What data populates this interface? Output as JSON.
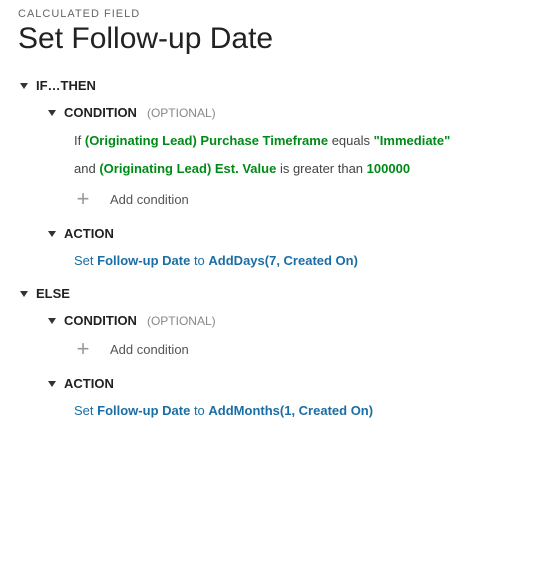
{
  "subtitle": "CALCULATED FIELD",
  "title": "Set Follow-up Date",
  "labels": {
    "ifthen": "IF…THEN",
    "condition": "CONDITION",
    "optional": "(OPTIONAL)",
    "action": "ACTION",
    "else": "ELSE",
    "add_condition": "Add condition"
  },
  "ifthen": {
    "conditions": [
      {
        "prefix": "If",
        "field": "(Originating Lead) Purchase Timeframe",
        "op": "equals",
        "value": "\"Immediate\""
      },
      {
        "prefix": "and",
        "field": "(Originating Lead) Est. Value",
        "op": "is greater than",
        "value": "100000"
      }
    ],
    "action": {
      "prefix": "Set",
      "field": "Follow-up Date",
      "mid": "to",
      "func": "AddDays(7, Created On)"
    }
  },
  "else": {
    "action": {
      "prefix": "Set",
      "field": "Follow-up Date",
      "mid": "to",
      "func": "AddMonths(1, Created On)"
    }
  }
}
